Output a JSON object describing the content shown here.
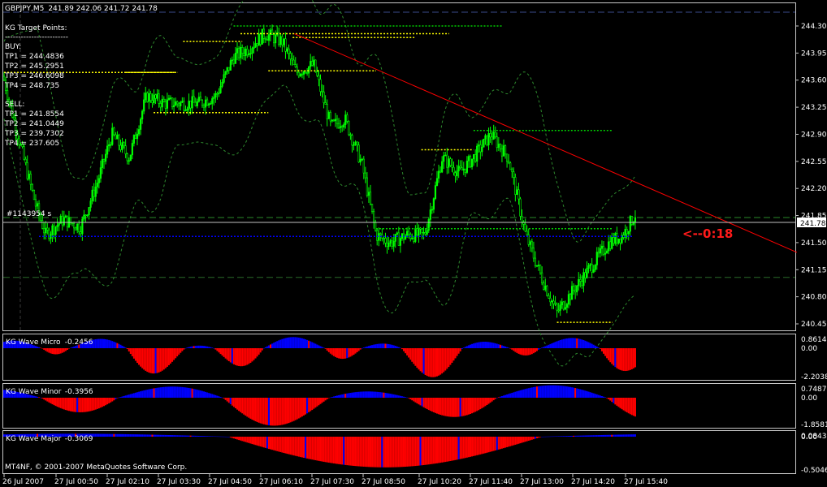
{
  "header": {
    "symbol": "GBPJPY,M5",
    "ohlc": "241.89 242.06 241.72 241.78"
  },
  "target_panel": {
    "title": "KG Target Points:",
    "separator": "------------------------",
    "buy_title": "BUY:",
    "buy": [
      "TP1 = 244.4836",
      "TP2 = 245.2951",
      "TP3 = 246.6098",
      "TP4 = 248.735"
    ],
    "sell_title": "SELL:",
    "sell": [
      "TP1 = 241.8554",
      "TP2 = 241.0449",
      "TP3 = 239.7302",
      "TP4 = 237.605"
    ]
  },
  "order_label": "#1143954  s",
  "current_price": "241.78",
  "distance_label": "<--0:18",
  "copyright": "MT4NF, © 2001-2007 MetaQuotes Software Corp.",
  "colors": {
    "background": "#000000",
    "bull": "#00ff00",
    "bear": "#ffffff",
    "envelope": "#2e8b2e",
    "target_line": "#ffff00",
    "green_level": "#00d000",
    "trend_line": "#ff0000",
    "order_line": "#0000ff",
    "histogram_positive": "#0000ff",
    "histogram_negative": "#ff0000"
  },
  "chart_data": [
    {
      "type": "candlestick",
      "name": "GBPJPY,M5",
      "x_ticks": [
        "26 Jul 2007",
        "27 Jul 00:50",
        "27 Jul 02:10",
        "27 Jul 03:30",
        "27 Jul 04:50",
        "27 Jul 06:10",
        "27 Jul 07:30",
        "27 Jul 08:50",
        "27 Jul 10:20",
        "27 Jul 11:40",
        "27 Jul 13:00",
        "27 Jul 14:20",
        "27 Jul 15:40"
      ],
      "y_ticks": [
        "244.30",
        "243.95",
        "243.60",
        "243.25",
        "242.90",
        "242.55",
        "242.20",
        "241.85",
        "241.50",
        "241.15",
        "240.80",
        "240.45"
      ],
      "ylim": [
        240.45,
        244.3
      ],
      "close_path": [
        [
          0,
          243.6
        ],
        [
          10,
          242.7
        ],
        [
          18,
          242.0
        ],
        [
          24,
          241.6
        ],
        [
          34,
          241.8
        ],
        [
          44,
          241.7
        ],
        [
          54,
          242.3
        ],
        [
          62,
          242.9
        ],
        [
          72,
          242.6
        ],
        [
          82,
          243.4
        ],
        [
          92,
          243.3
        ],
        [
          102,
          243.3
        ],
        [
          112,
          243.3
        ],
        [
          122,
          243.4
        ],
        [
          132,
          243.9
        ],
        [
          140,
          244.0
        ],
        [
          150,
          244.2
        ],
        [
          160,
          244.1
        ],
        [
          168,
          243.7
        ],
        [
          178,
          243.8
        ],
        [
          188,
          243.0
        ],
        [
          196,
          243.1
        ],
        [
          206,
          242.5
        ],
        [
          214,
          241.6
        ],
        [
          222,
          241.5
        ],
        [
          232,
          241.6
        ],
        [
          242,
          241.6
        ],
        [
          252,
          242.6
        ],
        [
          262,
          242.4
        ],
        [
          270,
          242.6
        ],
        [
          280,
          242.9
        ],
        [
          290,
          242.6
        ],
        [
          300,
          241.6
        ],
        [
          310,
          241.0
        ],
        [
          318,
          240.6
        ],
        [
          328,
          240.9
        ],
        [
          338,
          241.2
        ],
        [
          348,
          241.5
        ],
        [
          356,
          241.6
        ],
        [
          364,
          241.9
        ]
      ],
      "ohlc_last": {
        "open": 241.89,
        "high": 242.06,
        "low": 241.72,
        "close": 241.78
      },
      "target_lines": [
        {
          "price": 244.2,
          "from": 136,
          "to": 256
        },
        {
          "price": 244.15,
          "from": 166,
          "to": 236
        },
        {
          "price": 244.1,
          "from": 103,
          "to": 137
        },
        {
          "price": 243.7,
          "from": 0,
          "to": 98
        },
        {
          "price": 243.7,
          "from": 70,
          "to": 100
        },
        {
          "price": 243.72,
          "from": 152,
          "to": 214
        },
        {
          "price": 243.18,
          "from": 86,
          "to": 152
        },
        {
          "price": 242.7,
          "from": 240,
          "to": 270
        },
        {
          "price": 240.47,
          "from": 318,
          "to": 350
        }
      ],
      "green_levels": [
        {
          "price": 244.3,
          "from": 132,
          "to": 287
        },
        {
          "price": 242.95,
          "from": 270,
          "to": 350
        },
        {
          "price": 241.68,
          "from": 214,
          "to": 350
        }
      ],
      "trend_line": {
        "from": [
          167,
          244.2
        ],
        "to": [
          440,
          241.5
        ]
      },
      "order_line": {
        "price": 241.58
      },
      "current_price": 241.78
    },
    {
      "type": "histogram",
      "name": "KG Wave Micro",
      "value": "-0.2456",
      "y_ticks": [
        "0.8614",
        "0.00",
        "-2.2038"
      ],
      "ylim": [
        -2.2038,
        0.8614
      ]
    },
    {
      "type": "histogram",
      "name": "KG Wave Minor",
      "value": "-0.3956",
      "y_ticks": [
        "0.7487",
        "0.00",
        "-1.8581"
      ],
      "ylim": [
        -1.8581,
        0.7487
      ]
    },
    {
      "type": "histogram",
      "name": "KG Wave Major",
      "value": "-0.3069",
      "y_ticks": [
        "0.0843",
        "0.00",
        "-0.5046"
      ],
      "ylim": [
        -0.5046,
        0.0843
      ]
    }
  ]
}
